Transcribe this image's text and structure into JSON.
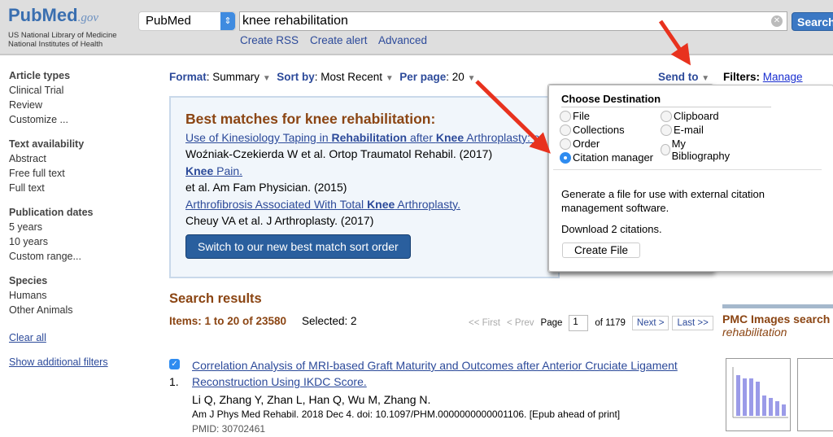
{
  "header": {
    "logo": "PubMed",
    "logo_suffix": ".gov",
    "org1": "US National Library of Medicine",
    "org2": "National Institutes of Health",
    "database": "PubMed",
    "query": "knee rehabilitation",
    "search_label": "Search",
    "links": [
      "Create RSS",
      "Create alert",
      "Advanced"
    ]
  },
  "sidebar": [
    {
      "heading": "Article types",
      "items": [
        "Clinical Trial",
        "Review",
        "Customize ..."
      ]
    },
    {
      "heading": "Text availability",
      "items": [
        "Abstract",
        "Free full text",
        "Full text"
      ]
    },
    {
      "heading": "Publication dates",
      "items": [
        "5 years",
        "10 years",
        "Custom range..."
      ]
    },
    {
      "heading": "Species",
      "items": [
        "Humans",
        "Other Animals"
      ]
    }
  ],
  "sidebar_links": {
    "clear": "Clear all",
    "more": "Show additional filters"
  },
  "toolbar": {
    "format_label": "Format",
    "format": "Summary",
    "sort_label": "Sort by",
    "sort": "Most Recent",
    "perpage_label": "Per page",
    "perpage": "20",
    "sendto": "Send to",
    "filters_label": "Filters:",
    "manage": "Manage Filters"
  },
  "best_matches": {
    "title": "Best matches for knee rehabilitation:",
    "items": [
      {
        "t1": "Use of Kinesiology Taping in ",
        "b1": "Rehabilitation",
        "t2": " after ",
        "b2": "Knee",
        "t3": " Arthroplasty: a",
        "cite": "Woźniak-Czekierda W et al. Ortop Traumatol Rehabil. (2017)"
      },
      {
        "t1": "",
        "b1": "Knee",
        "t2": " Pain.",
        "b2": "",
        "t3": "",
        "cite": "et al. Am Fam Physician. (2015)"
      },
      {
        "t1": "Arthrofibrosis Associated With Total ",
        "b1": "Knee",
        "t2": " Arthroplasty.",
        "b2": "",
        "t3": "",
        "cite": "Cheuy VA et al. J Arthroplasty. (2017)"
      }
    ],
    "button": "Switch to our new best match sort order"
  },
  "send_to": {
    "title": "Choose Destination",
    "options": [
      "File",
      "Collections",
      "Order",
      "Citation manager",
      "Clipboard",
      "E-mail",
      "My Bibliography"
    ],
    "selected": "Citation manager",
    "desc": "Generate a file for use with external citation management software.",
    "download": "Download 2 citations.",
    "button": "Create File"
  },
  "results": {
    "heading": "Search results",
    "items_text": "Items: 1 to 20 of 23580",
    "selected": "Selected: 2",
    "pager": {
      "first": "<< First",
      "prev": "< Prev",
      "page_label": "Page",
      "page": "1",
      "of": "of 1179",
      "next": "Next >",
      "last": "Last >>"
    },
    "list": [
      {
        "num": "1.",
        "checked": true,
        "title1": "Correlation Analysis of MRI-based Graft Maturity and Outcomes after Anterior Cruciate Ligament",
        "title2": "Reconstruction Using IKDC Score.",
        "authors": "Li Q, Zhang Y, Zhan L, Han Q, Wu M, Zhang N.",
        "journal": "Am J Phys Med Rehabil. 2018 Dec 4. doi: 10.1097/PHM.0000000000001106. [Epub ahead of print]",
        "pmid": "PMID: 30702461"
      }
    ]
  },
  "pmc": {
    "title": "PMC Images search",
    "sub": "rehabilitation"
  },
  "colors": {
    "accent": "#2c4a9a",
    "heading": "#8b4513",
    "arrow": "#e8321e"
  }
}
